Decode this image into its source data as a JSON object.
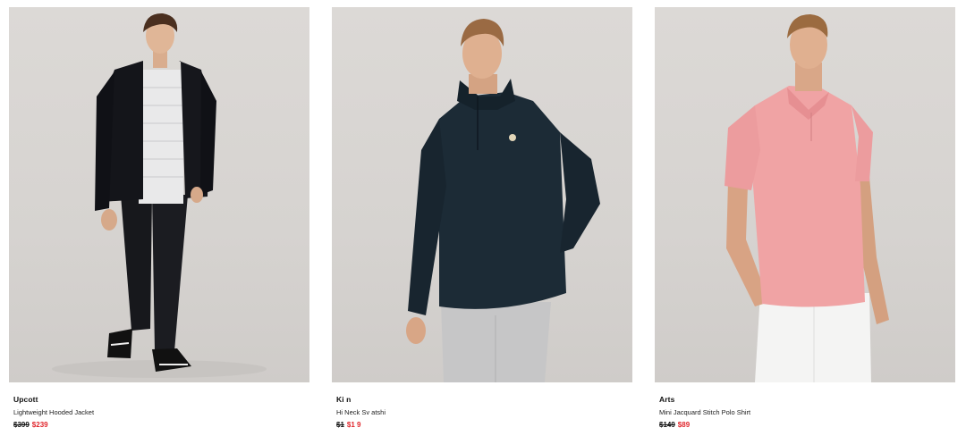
{
  "products": [
    {
      "name": "Upcott",
      "description": "Lightweight Hooded Jacket",
      "was_price": "$399",
      "sale_price": "$239",
      "image_alt": "Man wearing black hooded jacket, white striped tee, black trousers and sneakers"
    },
    {
      "name": "Ki  n",
      "description": "Hi   Neck Sv  atshi",
      "was_price": "$1",
      "sale_price": "$1  9",
      "image_alt": "Man wearing navy half-zip funnel neck sweatshirt and grey trousers"
    },
    {
      "name": "Arts",
      "description": "Mini Jacquard Stitch Polo Shirt",
      "was_price": "$149",
      "sale_price": "$89",
      "image_alt": "Man wearing pink polo shirt and white trousers"
    }
  ],
  "colors": {
    "sale": "#e0262c",
    "background": "#ffffff",
    "photo_backdrop": "#d8d5d2"
  }
}
